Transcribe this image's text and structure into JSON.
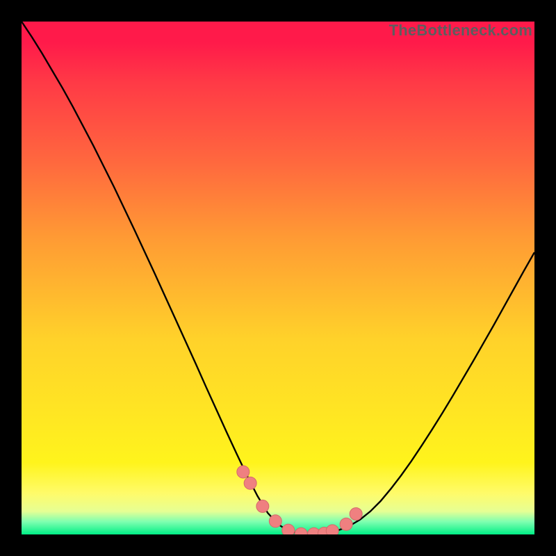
{
  "watermark": {
    "text": "TheBottleneck.com"
  },
  "colors": {
    "background": "#000000",
    "gradient_top": "#ff1a4a",
    "gradient_mid": "#ffd22a",
    "gradient_bottom": "#00ef86",
    "curve_stroke": "#000000",
    "marker_fill": "#ef8080",
    "marker_stroke": "#d46a6a"
  },
  "chart_data": {
    "type": "line",
    "title": "",
    "xlabel": "",
    "ylabel": "",
    "xlim": [
      0,
      100
    ],
    "ylim": [
      0,
      100
    ],
    "grid": false,
    "legend": false,
    "annotations": [
      "TheBottleneck.com"
    ],
    "x": [
      0,
      2,
      4,
      6,
      8,
      10,
      12,
      14,
      16,
      18,
      20,
      22,
      24,
      26,
      28,
      30,
      32,
      34,
      36,
      38,
      40,
      42,
      44,
      46,
      48,
      50,
      52,
      54,
      56,
      58,
      60,
      62,
      64,
      66,
      68,
      70,
      72,
      74,
      76,
      78,
      80,
      82,
      84,
      86,
      88,
      90,
      92,
      94,
      96,
      98,
      100
    ],
    "values": [
      100,
      97.0,
      93.8,
      90.4,
      87.0,
      83.4,
      79.6,
      75.8,
      71.8,
      67.8,
      63.6,
      59.4,
      55.1,
      50.8,
      46.4,
      42.0,
      37.6,
      33.2,
      28.7,
      24.3,
      19.9,
      15.6,
      11.4,
      7.5,
      4.2,
      2.0,
      0.7,
      0.2,
      0.0,
      0.1,
      0.4,
      0.9,
      1.7,
      2.9,
      4.5,
      6.5,
      8.9,
      11.5,
      14.3,
      17.3,
      20.4,
      23.6,
      26.9,
      30.3,
      33.7,
      37.2,
      40.7,
      44.3,
      47.9,
      51.5,
      55.0
    ],
    "markers": {
      "x": [
        43.2,
        44.6,
        47.0,
        49.5,
        52.0,
        54.5,
        57.0,
        59.0,
        60.6,
        63.3,
        65.2
      ],
      "y": [
        12.2,
        10.0,
        5.5,
        2.6,
        0.8,
        0.1,
        0.1,
        0.2,
        0.7,
        2.0,
        4.0
      ]
    }
  }
}
